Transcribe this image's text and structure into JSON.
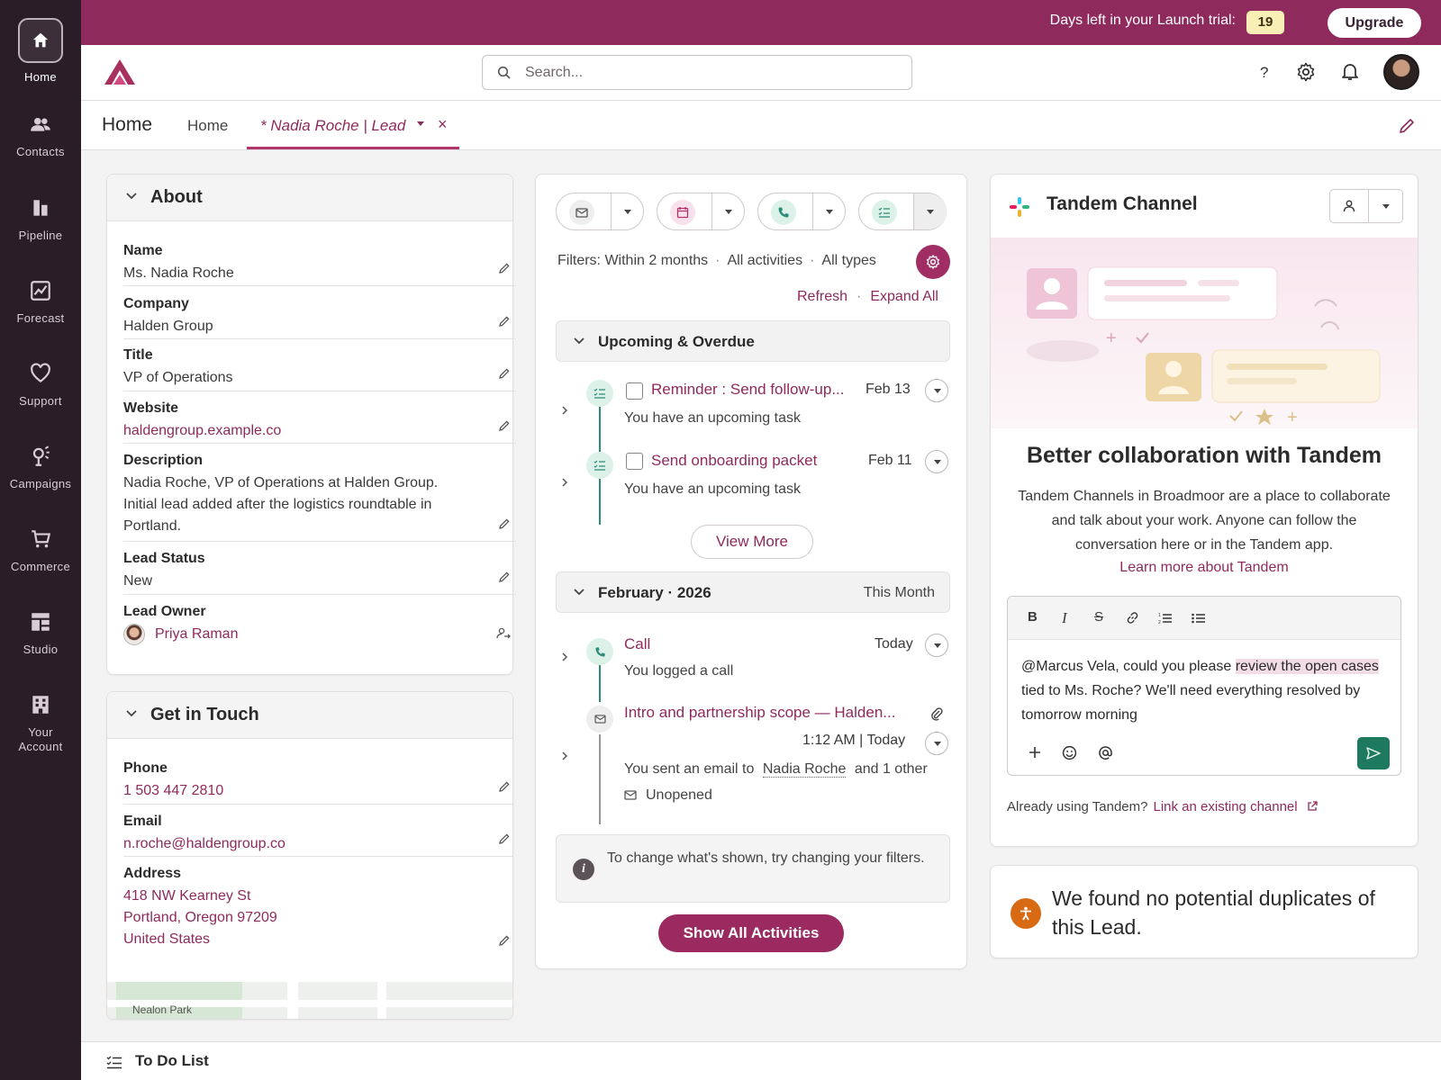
{
  "nav": [
    {
      "label": "Home",
      "icon": "home-icon"
    },
    {
      "label": "Contacts",
      "icon": "contacts-icon"
    },
    {
      "label": "Pipeline",
      "icon": "pipeline-icon"
    },
    {
      "label": "Forecast",
      "icon": "forecast-icon"
    },
    {
      "label": "Support",
      "icon": "heart-icon"
    },
    {
      "label": "Campaigns",
      "icon": "campaigns-icon"
    },
    {
      "label": "Commerce",
      "icon": "cart-icon"
    },
    {
      "label": "Studio",
      "icon": "studio-icon"
    },
    {
      "label": "Your Account",
      "icon": "building-icon"
    }
  ],
  "topbar": {
    "trial_text": "Days left in your Launch trial:",
    "trial_days": "19",
    "upgrade_label": "Upgrade"
  },
  "header": {
    "search_placeholder": "Search..."
  },
  "tabs": {
    "title": "Home",
    "home_tab": "Home",
    "active_tab": "* Nadia Roche | Lead",
    "close": "×"
  },
  "about": {
    "heading": "About",
    "fields": [
      {
        "label": "Name",
        "value": "Ms. Nadia Roche"
      },
      {
        "label": "Company",
        "value": "Halden Group"
      },
      {
        "label": "Title",
        "value": "VP of Operations"
      },
      {
        "label": "Website",
        "value": "haldengroup.example.co"
      },
      {
        "label": "Description",
        "value": "Nadia Roche, VP of Operations at Halden Group. Initial lead added after the logistics roundtable in Portland."
      },
      {
        "label": "Lead Status",
        "value": "New"
      },
      {
        "label": "Lead Owner",
        "value": "Priya Raman"
      }
    ]
  },
  "touch": {
    "heading": "Get in Touch",
    "phone_label": "Phone",
    "phone": "1 503 447 2810",
    "email_label": "Email",
    "email": "n.roche@haldengroup.co",
    "address_label": "Address",
    "address": [
      "418 NW Kearney St",
      "Portland, Oregon 97209",
      "United States"
    ],
    "map_label": "Nealon Park"
  },
  "activity": {
    "filters": "Filters: Within 2 months",
    "filter_activities": "All activities",
    "filter_types": "All types",
    "refresh": "Refresh",
    "expand_all": "Expand All",
    "upcoming_heading": "Upcoming & Overdue",
    "upcoming": [
      {
        "title": "Reminder : Send follow-up...",
        "date": "Feb 13",
        "sub": "You have an upcoming task"
      },
      {
        "title": "Send onboarding packet",
        "date": "Feb 11",
        "sub": "You have an upcoming task"
      }
    ],
    "view_more": "View More",
    "month_heading": "February · 2026",
    "month_tag": "This Month",
    "call": {
      "title": "Call",
      "date": "Today",
      "sub": "You logged a call"
    },
    "email": {
      "title": "Intro and partnership scope — Halden...",
      "date": "1:12 AM | Today",
      "sub_prefix": "You sent an email to",
      "sub_name": "Nadia Roche",
      "sub_suffix": "and 1 other",
      "status": "Unopened"
    },
    "info": "To change what's shown, try changing your filters.",
    "show_all": "Show All Activities"
  },
  "tandem": {
    "title": "Tandem Channel",
    "heading": "Better collaboration with Tandem",
    "body": "Tandem Channels in Broadmoor are a place to collaborate and talk about your work. Anyone can follow the conversation here or in the Tandem app.",
    "learn": "Learn more about Tandem",
    "toolbar": [
      "B",
      "I",
      "S"
    ],
    "message_mention": "@Marcus Vela",
    "message_1": ", could you please ",
    "message_hl": "review the open cases",
    "message_2": " tied to Ms. Roche? We'll need everything resolved by tomorrow morning",
    "already": "Already using Tandem?",
    "link": "Link an existing channel"
  },
  "duplicates": {
    "text": "We found no potential duplicates of this Lead."
  },
  "todo": {
    "label": "To Do List"
  },
  "colors": {
    "brand": "#8e2a5c",
    "sidebar": "#2a1d28",
    "accent_green": "#2c8c79"
  }
}
